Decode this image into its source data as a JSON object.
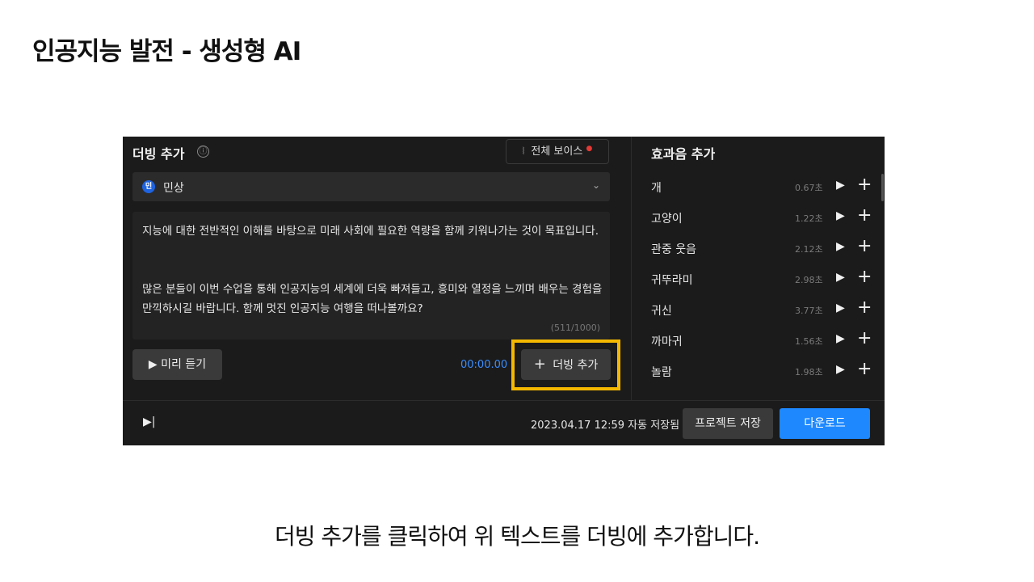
{
  "slide": {
    "title": "인공지능 발전 - 생성형 AI",
    "caption": "더빙 추가를 클릭하여 위 텍스트를 더빙에 추가합니다."
  },
  "dubbing": {
    "title": "더빙 추가",
    "info_icon": "ⓘ",
    "voice_button_label": "전체 보이스",
    "voice_badge": "민",
    "voice_name": "민상",
    "text_paragraph_1": "지능에 대한 전반적인 이해를 바탕으로 미래 사회에 필요한 역량을 함께 키워나가는 것이 목표입니다.",
    "text_paragraph_2": "많은 분들이 이번 수업을 통해 인공지능의 세계에 더욱 빠져들고, 흥미와 열정을 느끼며 배우는 경험을 만끽하시길 바랍니다. 함께 멋진 인공지능 여행을 떠나볼까요?",
    "char_count": "(511/1000)",
    "preview_label": "미리 듣기",
    "time": "00:00.00",
    "add_dub_label": "더빙 추가",
    "highlight_color": "#f5b800"
  },
  "sfx": {
    "title": "효과음 추가",
    "items": [
      {
        "name": "개",
        "duration": "0.67초"
      },
      {
        "name": "고양이",
        "duration": "1.22초"
      },
      {
        "name": "관중 웃음",
        "duration": "2.12초"
      },
      {
        "name": "귀뚜라미",
        "duration": "2.98초"
      },
      {
        "name": "귀신",
        "duration": "3.77초"
      },
      {
        "name": "까마귀",
        "duration": "1.56초"
      },
      {
        "name": "놀람",
        "duration": "1.98초"
      }
    ]
  },
  "footer": {
    "saved_status": "2023.04.17 12:59 자동 저장됨",
    "save_project_label": "프로젝트 저장",
    "download_label": "다운로드"
  },
  "colors": {
    "accent": "#1e88ff",
    "time": "#3a8dff",
    "background": "#1b1b1b"
  }
}
